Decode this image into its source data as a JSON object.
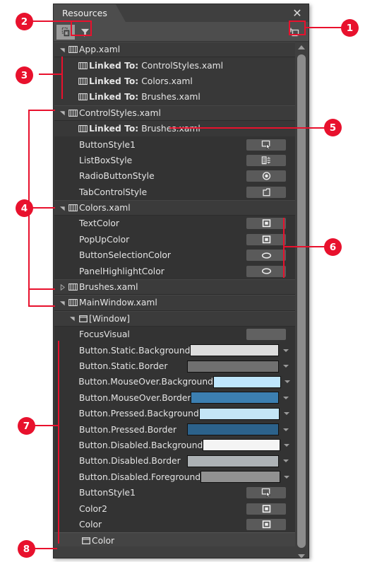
{
  "panel": {
    "tab_label": "Resources",
    "close_icon": "close-icon"
  },
  "toolbar": {
    "copy_label": "copy-resources-icon",
    "filter_label": "filter-icon",
    "add_resource_label": "add-resource-dictionary-icon"
  },
  "scrollbar": {
    "up_label": "scroll-up-arrow",
    "down_label": "scroll-down-arrow"
  },
  "tree": {
    "rows": [
      {
        "id": "app-xaml",
        "kind": "hdr",
        "indent": 0,
        "twisty": "open",
        "icon": "dictionary",
        "label": "App.xaml"
      },
      {
        "id": "app-link-control",
        "kind": "linked",
        "indent": 1,
        "twisty": "none",
        "icon": "dictionary",
        "prefix": "Linked To:",
        "label": "ControlStyles.xaml"
      },
      {
        "id": "app-link-colors",
        "kind": "linked",
        "indent": 1,
        "twisty": "none",
        "icon": "dictionary",
        "prefix": "Linked To:",
        "label": "Colors.xaml"
      },
      {
        "id": "app-link-brushes",
        "kind": "linked",
        "indent": 1,
        "twisty": "none",
        "icon": "dictionary",
        "prefix": "Linked To:",
        "label": "Brushes.xaml"
      },
      {
        "id": "controlstyles-xaml",
        "kind": "hdr",
        "indent": 0,
        "twisty": "open",
        "icon": "dictionary",
        "label": "ControlStyles.xaml"
      },
      {
        "id": "cs-link-brushes",
        "kind": "linked",
        "indent": 1,
        "twisty": "none",
        "icon": "dictionary",
        "prefix": "Linked To:",
        "label": "Brushes.xaml"
      },
      {
        "id": "buttonstyle1-a",
        "kind": "item",
        "indent": 1,
        "twisty": "none",
        "icon": "none",
        "label": "ButtonStyle1",
        "value": {
          "type": "glyph",
          "glyph": "control-button-icon"
        }
      },
      {
        "id": "listboxstyle",
        "kind": "item",
        "indent": 1,
        "twisty": "none",
        "icon": "none",
        "label": "ListBoxStyle",
        "value": {
          "type": "glyph",
          "glyph": "control-listbox-icon"
        }
      },
      {
        "id": "radiobuttonstyle",
        "kind": "item",
        "indent": 1,
        "twisty": "none",
        "icon": "none",
        "label": "RadioButtonStyle",
        "value": {
          "type": "glyph",
          "glyph": "control-radiobutton-icon"
        }
      },
      {
        "id": "tabcontrolstyle",
        "kind": "item",
        "indent": 1,
        "twisty": "none",
        "icon": "none",
        "label": "TabControlStyle",
        "value": {
          "type": "glyph",
          "glyph": "control-tabcontrol-icon"
        }
      },
      {
        "id": "colors-xaml",
        "kind": "hdr",
        "indent": 0,
        "twisty": "open",
        "icon": "dictionary",
        "label": "Colors.xaml"
      },
      {
        "id": "textcolor",
        "kind": "item",
        "indent": 1,
        "twisty": "none",
        "icon": "none",
        "label": "TextColor",
        "value": {
          "type": "glyph",
          "glyph": "color-square-icon"
        }
      },
      {
        "id": "popupcolor",
        "kind": "item",
        "indent": 1,
        "twisty": "none",
        "icon": "none",
        "label": "PopUpColor",
        "value": {
          "type": "glyph",
          "glyph": "color-square-icon"
        }
      },
      {
        "id": "buttonselectioncolor",
        "kind": "item",
        "indent": 1,
        "twisty": "none",
        "icon": "none",
        "label": "ButtonSelectionColor",
        "value": {
          "type": "glyph",
          "glyph": "brush-ellipse-icon"
        }
      },
      {
        "id": "panelhighlightcolor",
        "kind": "item",
        "indent": 1,
        "twisty": "none",
        "icon": "none",
        "label": "PanelHighlightColor",
        "value": {
          "type": "glyph",
          "glyph": "brush-ellipse-icon"
        }
      },
      {
        "id": "brushes-xaml",
        "kind": "hdr",
        "indent": 0,
        "twisty": "closed",
        "icon": "dictionary",
        "label": "Brushes.xaml"
      },
      {
        "id": "mainwindow-xaml",
        "kind": "hdr",
        "indent": 0,
        "twisty": "open",
        "icon": "dictionary",
        "label": "MainWindow.xaml"
      },
      {
        "id": "window-node",
        "kind": "subhdr",
        "indent": 1,
        "twisty": "open",
        "icon": "window",
        "label": "[Window]"
      },
      {
        "id": "focusvisual",
        "kind": "item",
        "indent": 1,
        "twisty": "none",
        "icon": "none",
        "label": "FocusVisual",
        "value": {
          "type": "blank"
        }
      },
      {
        "id": "btn-static-bg",
        "kind": "item",
        "indent": 1,
        "twisty": "none",
        "icon": "none",
        "label": "Button.Static.Background",
        "value": {
          "type": "color",
          "color": "#DDDDDD"
        }
      },
      {
        "id": "btn-static-border",
        "kind": "item",
        "indent": 1,
        "twisty": "none",
        "icon": "none",
        "label": "Button.Static.Border",
        "value": {
          "type": "color",
          "color": "#707070"
        }
      },
      {
        "id": "btn-mouseover-bg",
        "kind": "item",
        "indent": 1,
        "twisty": "none",
        "icon": "none",
        "label": "Button.MouseOver.Background",
        "value": {
          "type": "color",
          "color": "#BEE6FD"
        }
      },
      {
        "id": "btn-mouseover-border",
        "kind": "item",
        "indent": 1,
        "twisty": "none",
        "icon": "none",
        "label": "Button.MouseOver.Border",
        "value": {
          "type": "color",
          "color": "#3C7FB1"
        }
      },
      {
        "id": "btn-pressed-bg",
        "kind": "item",
        "indent": 1,
        "twisty": "none",
        "icon": "none",
        "label": "Button.Pressed.Background",
        "value": {
          "type": "color",
          "color": "#C4E5F6"
        }
      },
      {
        "id": "btn-pressed-border",
        "kind": "item",
        "indent": 1,
        "twisty": "none",
        "icon": "none",
        "label": "Button.Pressed.Border",
        "value": {
          "type": "color",
          "color": "#2C628B"
        }
      },
      {
        "id": "btn-disabled-bg",
        "kind": "item",
        "indent": 1,
        "twisty": "none",
        "icon": "none",
        "label": "Button.Disabled.Background",
        "value": {
          "type": "color",
          "color": "#F4F4F4"
        }
      },
      {
        "id": "btn-disabled-border",
        "kind": "item",
        "indent": 1,
        "twisty": "none",
        "icon": "none",
        "label": "Button.Disabled.Border",
        "value": {
          "type": "color",
          "color": "#ADB2B5"
        }
      },
      {
        "id": "btn-disabled-fg",
        "kind": "item",
        "indent": 1,
        "twisty": "none",
        "icon": "none",
        "label": "Button.Disabled.Foreground",
        "value": {
          "type": "color",
          "color": "#919191"
        }
      },
      {
        "id": "buttonstyle1-b",
        "kind": "item",
        "indent": 1,
        "twisty": "none",
        "icon": "none",
        "label": "ButtonStyle1",
        "value": {
          "type": "glyph",
          "glyph": "control-button-icon"
        }
      },
      {
        "id": "color2",
        "kind": "item",
        "indent": 1,
        "twisty": "none",
        "icon": "none",
        "label": "Color2",
        "value": {
          "type": "glyph",
          "glyph": "color-square-icon"
        }
      },
      {
        "id": "color",
        "kind": "item",
        "indent": 1,
        "twisty": "none",
        "icon": "none",
        "label": "Color",
        "value": {
          "type": "glyph",
          "glyph": "color-square-icon"
        }
      },
      {
        "id": "color-footer",
        "kind": "footer",
        "indent": 2,
        "twisty": "none",
        "icon": "window",
        "label": "Color"
      }
    ]
  },
  "callouts": [
    {
      "n": "1"
    },
    {
      "n": "2"
    },
    {
      "n": "3"
    },
    {
      "n": "4"
    },
    {
      "n": "5"
    },
    {
      "n": "6"
    },
    {
      "n": "7"
    },
    {
      "n": "8"
    }
  ],
  "colors": {
    "accent_red": "#e8112d",
    "panel_bg": "#3f3f3f",
    "tree_bg": "#333333",
    "header_bg": "#3b3b3b",
    "text": "#e4e4e4"
  }
}
